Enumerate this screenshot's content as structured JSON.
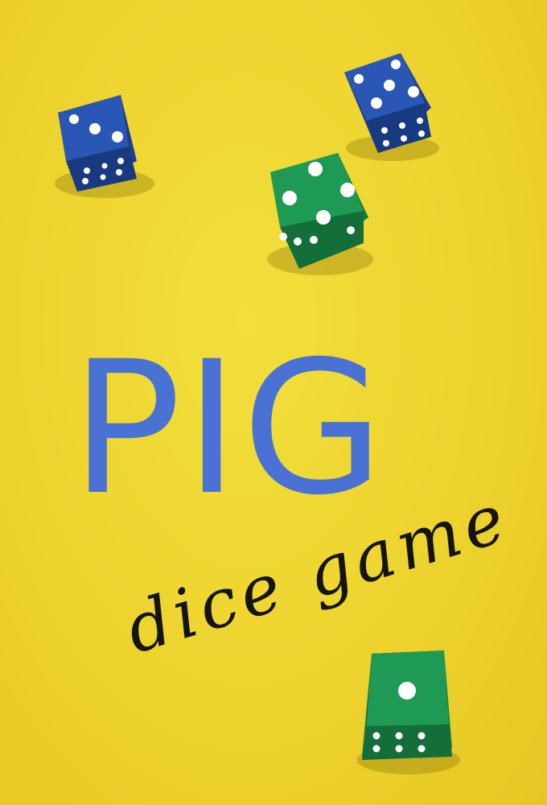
{
  "image": {
    "title": "PIG",
    "subtitle": "dice game",
    "colors": {
      "background": "#eed32e",
      "title": "#4a72d4",
      "subtitle": "#141414",
      "blue_die": "#2a56b6",
      "green_die": "#1f9a55",
      "pips": "#ffffff"
    },
    "dice": [
      {
        "color": "blue",
        "top_face": 3
      },
      {
        "color": "blue",
        "top_face": 5
      },
      {
        "color": "green",
        "top_face": 4
      },
      {
        "color": "green",
        "top_face": 1
      }
    ]
  }
}
